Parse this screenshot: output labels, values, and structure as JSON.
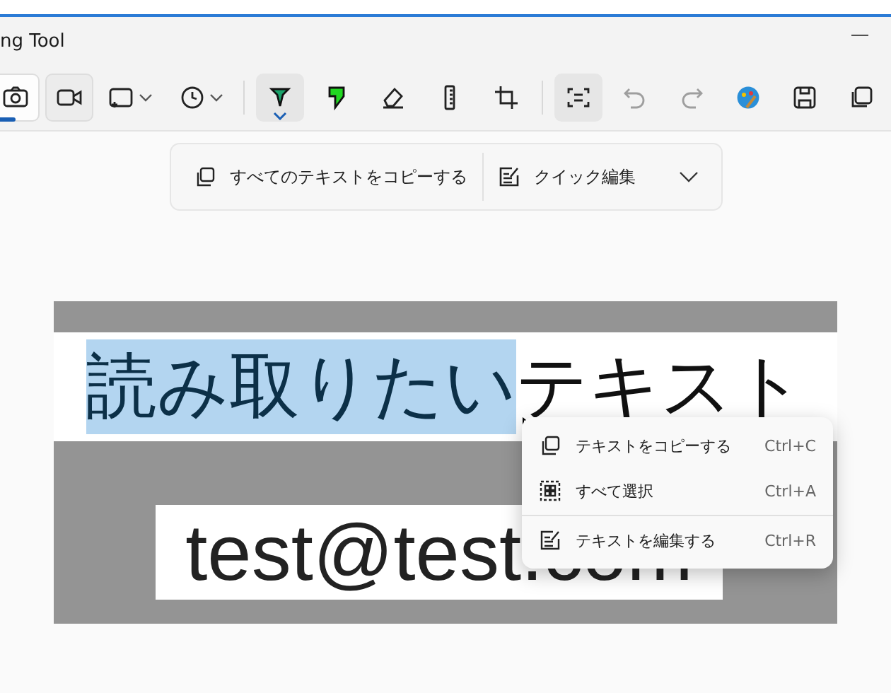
{
  "window": {
    "title": "ng Tool",
    "minimize": "—"
  },
  "toolbar": {
    "tools": [
      {
        "selected": true,
        "disabled": false,
        "dropdown": false
      },
      {
        "selected": false,
        "disabled": false,
        "dropdown": false
      },
      {
        "selected": false,
        "disabled": false,
        "dropdown": true
      },
      {
        "selected": false,
        "disabled": false,
        "dropdown": true
      },
      {
        "selected": true,
        "disabled": false,
        "dropdown": false
      },
      {
        "selected": false,
        "disabled": false,
        "dropdown": false
      },
      {
        "selected": false,
        "disabled": false,
        "dropdown": false
      },
      {
        "selected": false,
        "disabled": false,
        "dropdown": false
      },
      {
        "selected": false,
        "disabled": false,
        "dropdown": false
      },
      {
        "selected": true,
        "disabled": false,
        "dropdown": false
      },
      {
        "selected": false,
        "disabled": true,
        "dropdown": false
      },
      {
        "selected": false,
        "disabled": true,
        "dropdown": false
      },
      {
        "selected": false,
        "disabled": false,
        "dropdown": false
      },
      {
        "selected": false,
        "disabled": false,
        "dropdown": false
      },
      {
        "selected": false,
        "disabled": false,
        "dropdown": false
      }
    ]
  },
  "text_bar": {
    "copy_all": "すべてのテキストをコピーする",
    "quick_edit": "クイック編集"
  },
  "capture": {
    "line_1": [
      {
        "text": "読み取りたい",
        "selected": true
      },
      {
        "text": "テキスト",
        "selected": false
      }
    ],
    "line_2": "test@test.com"
  },
  "context_menu": {
    "items": [
      {
        "label": "テキストをコピーする",
        "shortcut": "Ctrl+C"
      },
      {
        "label": "すべて選択",
        "shortcut": "Ctrl+A"
      },
      {
        "label": "テキストを編集する",
        "shortcut": "Ctrl+R"
      }
    ]
  }
}
